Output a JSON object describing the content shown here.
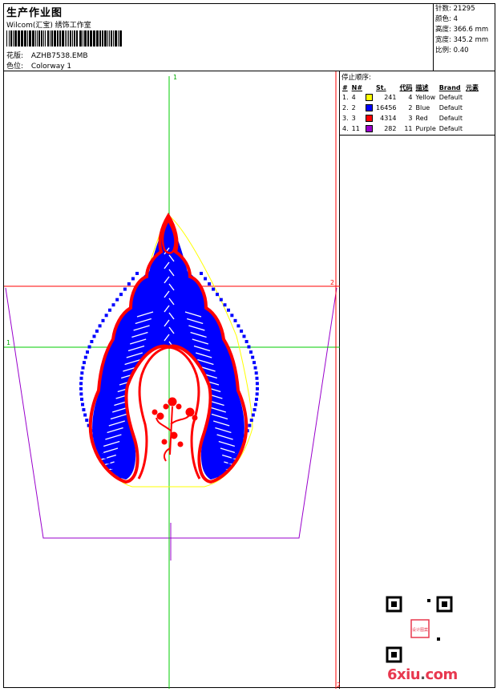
{
  "header": {
    "title": "生产作业图",
    "company": "Wilcom(汇宝) 绣饰工作室",
    "design_label": "花版:",
    "design_value": "AZHB7538.EMB",
    "colorway_label": "色位:",
    "colorway_value": "Colorway 1"
  },
  "stats": [
    {
      "label": "针数:",
      "value": "21295"
    },
    {
      "label": "颜色:",
      "value": "4"
    },
    {
      "label": "高度:",
      "value": "366.6 mm"
    },
    {
      "label": "宽度:",
      "value": "345.2 mm"
    },
    {
      "label": "比例:",
      "value": "0.40"
    }
  ],
  "stop_sequence": {
    "title": "停止顺序:",
    "columns": [
      "#",
      "N#",
      "St.",
      "代码",
      "描述",
      "Brand",
      "元素"
    ],
    "rows": [
      {
        "idx": "1.",
        "n": "4",
        "color": "#ffff00",
        "st": "241",
        "code": "4",
        "desc": "Yellow",
        "brand": "Default"
      },
      {
        "idx": "2.",
        "n": "2",
        "color": "#0000ff",
        "st": "16456",
        "code": "2",
        "desc": "Blue",
        "brand": "Default"
      },
      {
        "idx": "3.",
        "n": "3",
        "color": "#ff0000",
        "st": "4314",
        "code": "3",
        "desc": "Red",
        "brand": "Default"
      },
      {
        "idx": "4.",
        "n": "11",
        "color": "#9900cc",
        "st": "282",
        "code": "11",
        "desc": "Purple",
        "brand": "Default"
      }
    ]
  },
  "guides": {
    "v1": "1",
    "h1": "1",
    "h2": "2",
    "v2": "2"
  },
  "watermark": {
    "logo_main": "6xiu",
    "logo_dot": ".",
    "logo_tail": "com",
    "stamp_text": "设计图案"
  },
  "colors": {
    "yellow": "#ffff00",
    "blue": "#0000ff",
    "red": "#ff0000",
    "purple": "#9900cc",
    "guide_green": "#00cc00",
    "guide_red": "#ff0000"
  }
}
